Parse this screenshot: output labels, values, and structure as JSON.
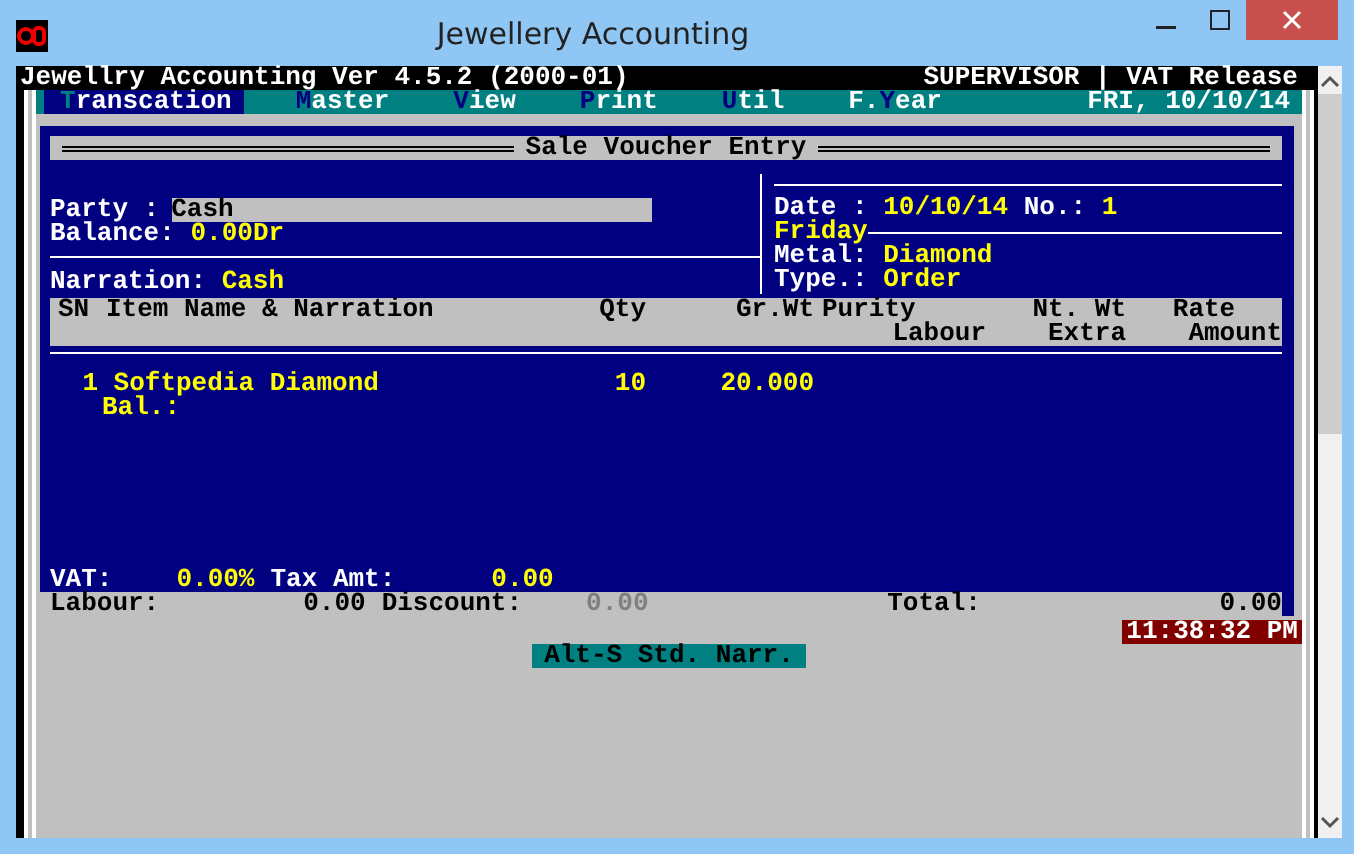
{
  "window": {
    "title": "Jewellery Accounting"
  },
  "app_header": {
    "title": "Jewellry Accounting Ver 4.5.2 (2000-01)",
    "user": "SUPERVISOR",
    "separator": "|",
    "mode": "VAT Release"
  },
  "menu": [
    {
      "hotkey": "T",
      "rest": "ranscation",
      "selected": true
    },
    {
      "hotkey": "M",
      "rest": "aster",
      "selected": false
    },
    {
      "hotkey": "V",
      "rest": "iew",
      "selected": false
    },
    {
      "hotkey": "P",
      "rest": "rint",
      "selected": false
    },
    {
      "hotkey": "U",
      "rest": "til",
      "selected": false
    },
    {
      "prefix": "F.",
      "hotkey": "Y",
      "rest": "ear",
      "selected": false
    }
  ],
  "menu_date": "FRI, 10/10/14",
  "form": {
    "title": "Sale Voucher Entry",
    "party": {
      "label": "Party :",
      "value": "Cash"
    },
    "balance": {
      "label": "Balance:",
      "value": "0.00Dr"
    },
    "narration": {
      "label": "Narration:",
      "value": "Cash"
    },
    "date": {
      "label": "Date :",
      "value": "10/10/14"
    },
    "number": {
      "label": "No.:",
      "value": "1"
    },
    "weekday": "Friday",
    "metal": {
      "label": "Metal:",
      "value": "Diamond"
    },
    "type": {
      "label": "Type.:",
      "value": "Order"
    }
  },
  "table": {
    "columns": [
      {
        "top": "SN"
      },
      {
        "top": "Item Name & Narration"
      },
      {
        "top": "Qty"
      },
      {
        "top": "Gr.Wt"
      },
      {
        "top": "Purity",
        "bottom": "Labour"
      },
      {
        "top": "Nt. Wt",
        "bottom": "Extra"
      },
      {
        "top": "Rate",
        "bottom": "Amount"
      }
    ],
    "rows": [
      {
        "sn": "1",
        "item": "Softpedia Diamond",
        "qty": "10",
        "gr_wt": "20.000",
        "sub": "Bal.:"
      }
    ]
  },
  "vat": {
    "label": "VAT:",
    "value": "0.00%",
    "tax_label": "Tax Amt:",
    "tax_value": "0.00"
  },
  "totals": {
    "labour_label": "Labour:",
    "labour": "0.00",
    "discount_label": "Discount:",
    "discount": "0.00",
    "discount_disabled": true,
    "total_label": "Total:",
    "total": "0.00"
  },
  "clock": "11:38:32 PM",
  "hint": "Alt-S Std. Narr."
}
